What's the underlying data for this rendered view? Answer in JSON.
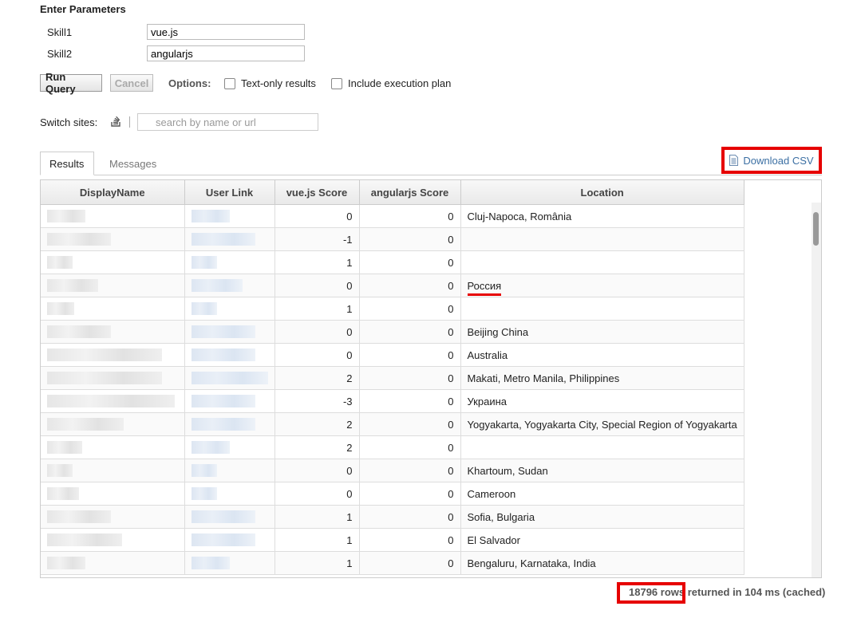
{
  "params": {
    "title": "Enter Parameters",
    "fields": [
      {
        "label": "Skill1",
        "value": "vue.js"
      },
      {
        "label": "Skill2",
        "value": "angularjs"
      }
    ]
  },
  "toolbar": {
    "run_label": "Run Query",
    "cancel_label": "Cancel",
    "options_label": "Options:",
    "text_only_label": "Text-only results",
    "exec_plan_label": "Include execution plan"
  },
  "switch_sites": {
    "label": "Switch sites:",
    "placeholder": "search by name or url",
    "icon": "stack-overflow-icon"
  },
  "tabs": [
    {
      "label": "Results",
      "active": true
    },
    {
      "label": "Messages",
      "active": false
    }
  ],
  "download_csv": {
    "label": "Download CSV",
    "icon": "document-icon"
  },
  "table": {
    "columns": [
      "DisplayName",
      "User Link",
      "vue.js Score",
      "angularjs Score",
      "Location"
    ],
    "rows": [
      {
        "vue": "0",
        "angular": "0",
        "location": "Cluj-Napoca, România"
      },
      {
        "vue": "-1",
        "angular": "0",
        "location": ""
      },
      {
        "vue": "1",
        "angular": "0",
        "location": ""
      },
      {
        "vue": "0",
        "angular": "0",
        "location": "Россия"
      },
      {
        "vue": "1",
        "angular": "0",
        "location": ""
      },
      {
        "vue": "0",
        "angular": "0",
        "location": "Beijing China"
      },
      {
        "vue": "0",
        "angular": "0",
        "location": "Australia"
      },
      {
        "vue": "2",
        "angular": "0",
        "location": "Makati, Metro Manila, Philippines"
      },
      {
        "vue": "-3",
        "angular": "0",
        "location": "Украина"
      },
      {
        "vue": "2",
        "angular": "0",
        "location": "Yogyakarta, Yogyakarta City, Special Region of Yogyakarta"
      },
      {
        "vue": "2",
        "angular": "0",
        "location": ""
      },
      {
        "vue": "0",
        "angular": "0",
        "location": "Khartoum, Sudan"
      },
      {
        "vue": "0",
        "angular": "0",
        "location": "Cameroon"
      },
      {
        "vue": "1",
        "angular": "0",
        "location": "Sofia, Bulgaria"
      },
      {
        "vue": "1",
        "angular": "0",
        "location": "El Salvador"
      },
      {
        "vue": "1",
        "angular": "0",
        "location": "Bengaluru, Karnataka, India"
      }
    ]
  },
  "status": {
    "rows_count": "18796 rows",
    "suffix": " returned in 104 ms (cached)"
  },
  "colors": {
    "highlight_red": "#e60000",
    "link_blue": "#3b6fa3"
  }
}
